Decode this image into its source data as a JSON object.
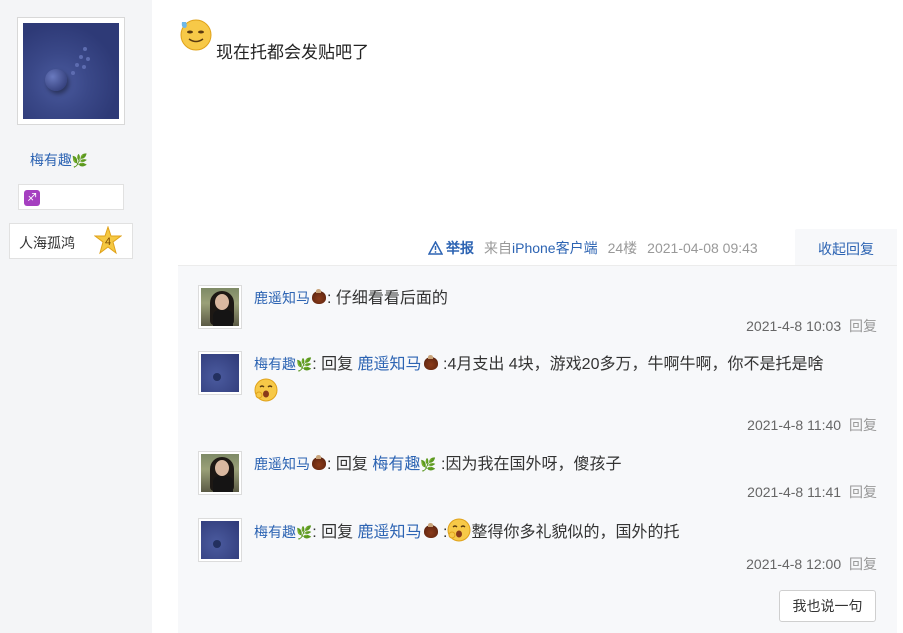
{
  "author": {
    "name": "梅有趣",
    "badge_icon": "sagittarius-icon",
    "forum_title": "人海孤鸿",
    "level": "4"
  },
  "post": {
    "text": "现在托都会发贴吧了",
    "emoji": "sweat-smile-emoji"
  },
  "post_tail": {
    "report_label": "举报",
    "source_prefix": "来自",
    "source_device": "iPhone客户端",
    "floor": "24楼",
    "time": "2021-04-08 09:43",
    "collapse_label": "收起回复"
  },
  "replies": [
    {
      "user": "鹿遥知马",
      "prefix": ": ",
      "reply_word": "",
      "reply_to": "",
      "text": "仔细看看后面的",
      "time": "2021-4-8 10:03",
      "action": "回复"
    },
    {
      "user": "梅有趣",
      "prefix": ": ",
      "reply_word": "回复 ",
      "reply_to": "鹿遥知马",
      "text": " :4月支出 4块，游戏20多万，牛啊牛啊，你不是托是啥",
      "time": "2021-4-8 11:40",
      "action": "回复"
    },
    {
      "user": "鹿遥知马",
      "prefix": ": ",
      "reply_word": "回复 ",
      "reply_to": "梅有趣",
      "text": " :因为我在国外呀，傻孩子",
      "time": "2021-4-8 11:41",
      "action": "回复"
    },
    {
      "user": "梅有趣",
      "prefix": ": ",
      "reply_word": "回复 ",
      "reply_to": "鹿遥知马",
      "text": "整得你多礼貌似的，国外的托",
      "time": "2021-4-8 12:00",
      "action": "回复"
    }
  ],
  "say_button_label": "我也说一句",
  "colors": {
    "link": "#2d64b3",
    "panel_bg": "#f7f8fa",
    "sidebar_bg": "#f4f5f7"
  }
}
